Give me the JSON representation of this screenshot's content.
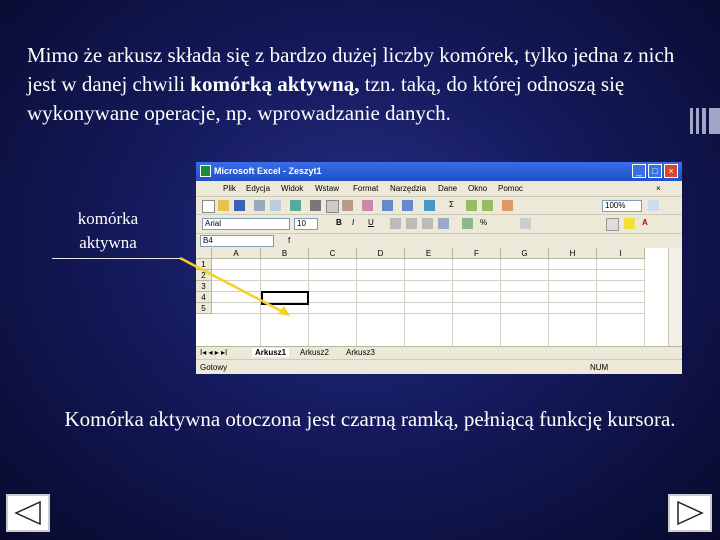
{
  "slide": {
    "intro_before": "Mimo że arkusz składa się z bardzo dużej liczby komórek, tylko jedna z nich jest w danej chwili ",
    "intro_bold": "komórką aktywną,",
    "intro_after": " tzn. taką, do której odnoszą się wykonywane operacje, np. wprowadzanie danych.",
    "callout": "komórka aktywna",
    "caption": "Komórka aktywna otoczona jest czarną ramką, pełniącą funkcję kursora.",
    "prev_label": "previous",
    "next_label": "next"
  },
  "excel": {
    "title": "Microsoft Excel - Zeszyt1",
    "menu": [
      "Plik",
      "Edycja",
      "Widok",
      "Wstaw",
      "Format",
      "Narzędzia",
      "Dane",
      "Okno",
      "Pomoc"
    ],
    "zoom": "100%",
    "font_name": "Arial",
    "font_size": "10",
    "name_box": "B4",
    "columns": [
      "A",
      "B",
      "C",
      "D",
      "E",
      "F",
      "G",
      "H",
      "I"
    ],
    "rows": [
      "1",
      "2",
      "3",
      "4",
      "5"
    ],
    "active_cell": {
      "column": "B",
      "row": "4"
    },
    "sheets": [
      "Arkusz1",
      "Arkusz2",
      "Arkusz3"
    ],
    "status_left": "Gotowy",
    "status_right": "NUM"
  },
  "colors": {
    "arrow": "#f2d02a",
    "callout_line": "#e6e6e6",
    "title_bar": "#2459d6"
  }
}
